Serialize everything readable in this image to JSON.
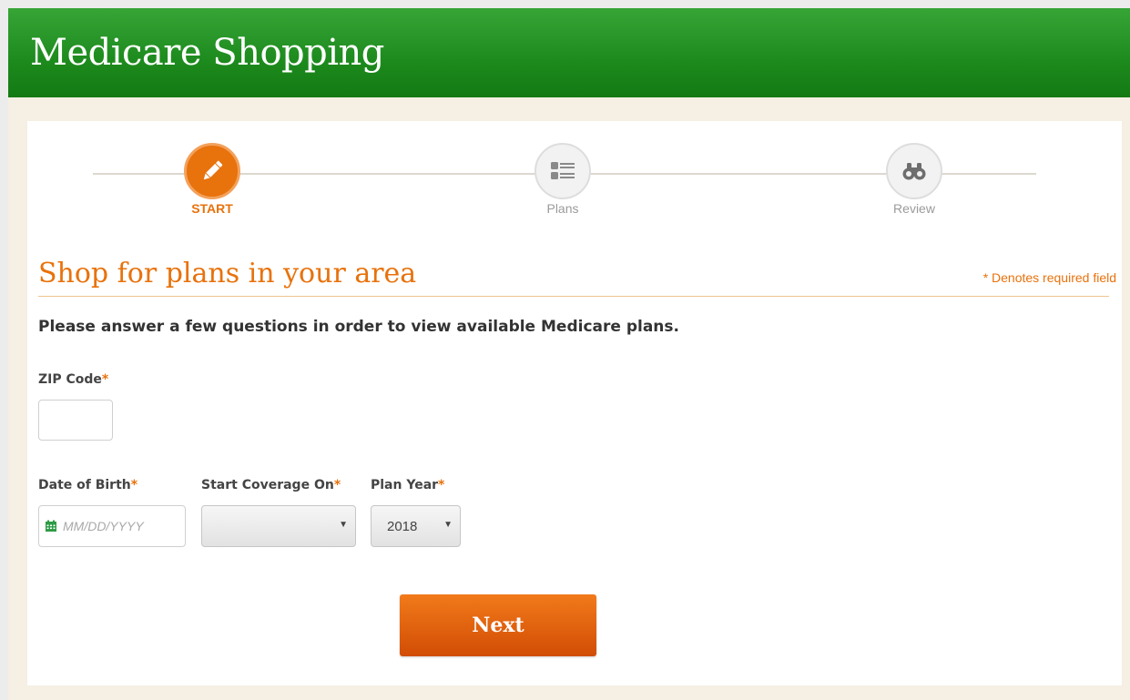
{
  "header": {
    "title": "Medicare Shopping"
  },
  "steps": [
    {
      "label": "START",
      "icon": "pencil-icon"
    },
    {
      "label": "Plans",
      "icon": "list-icon"
    },
    {
      "label": "Review",
      "icon": "binoculars-icon"
    }
  ],
  "form": {
    "title": "Shop for plans in your area",
    "required_note": "* Denotes required field",
    "intro": "Please answer a few questions in order to view available Medicare plans.",
    "required_marker": "*",
    "zip": {
      "label": "ZIP Code",
      "value": ""
    },
    "dob": {
      "label": "Date of Birth",
      "placeholder": "MM/DD/YYYY",
      "icon": "calendar-icon"
    },
    "coverage": {
      "label": "Start Coverage On",
      "value": ""
    },
    "plan_year": {
      "label": "Plan Year",
      "value": "2018"
    },
    "next_label": "Next"
  },
  "colors": {
    "header_green": "#1d8a1d",
    "accent_orange": "#e8720c",
    "background": "#f5efe4"
  }
}
